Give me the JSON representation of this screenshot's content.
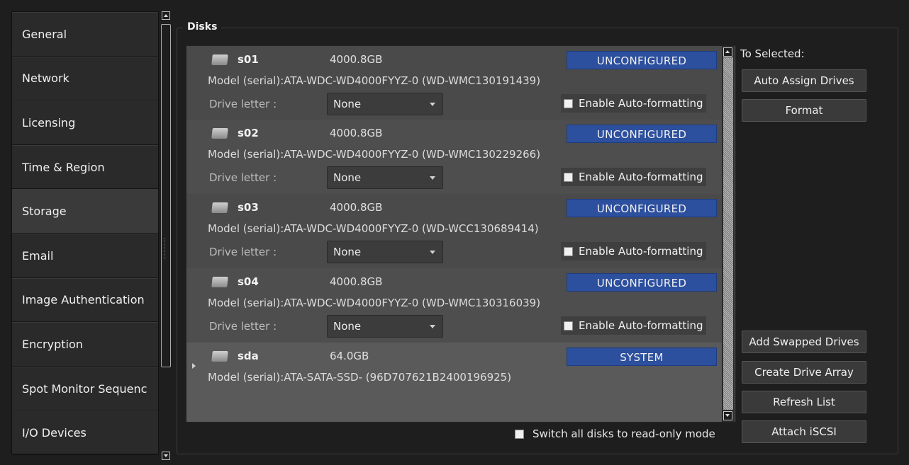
{
  "sidebar": {
    "items": [
      {
        "label": "General"
      },
      {
        "label": "Network"
      },
      {
        "label": "Licensing"
      },
      {
        "label": "Time & Region"
      },
      {
        "label": "Storage"
      },
      {
        "label": "Email"
      },
      {
        "label": "Image Authentication"
      },
      {
        "label": "Encryption"
      },
      {
        "label": "Spot Monitor Sequenc"
      },
      {
        "label": "I/O Devices"
      }
    ],
    "active_index": 4
  },
  "disks_group": {
    "title": "Disks",
    "drive_letter_label": "Drive letter :",
    "autoformat_label": "Enable Auto-formatting",
    "disks": [
      {
        "name": "s01",
        "size": "4000.8GB",
        "status": "UNCONFIGURED",
        "model": "Model (serial):ATA-WDC-WD4000FYYZ-0 (WD-WMC130191439)",
        "drive_letter": "None",
        "auto_format": false
      },
      {
        "name": "s02",
        "size": "4000.8GB",
        "status": "UNCONFIGURED",
        "model": "Model (serial):ATA-WDC-WD4000FYYZ-0 (WD-WMC130229266)",
        "drive_letter": "None",
        "auto_format": false
      },
      {
        "name": "s03",
        "size": "4000.8GB",
        "status": "UNCONFIGURED",
        "model": "Model (serial):ATA-WDC-WD4000FYYZ-0 (WD-WCC130689414)",
        "drive_letter": "None",
        "auto_format": false
      },
      {
        "name": "s04",
        "size": "4000.8GB",
        "status": "UNCONFIGURED",
        "model": "Model (serial):ATA-WDC-WD4000FYYZ-0 (WD-WMC130316039)",
        "drive_letter": "None",
        "auto_format": false
      },
      {
        "name": "sda",
        "size": "64.0GB",
        "status": "SYSTEM",
        "model": "Model (serial):ATA-SATA-SSD- (96D707621B2400196925)"
      }
    ],
    "to_selected_label": "To Selected:",
    "buttons": {
      "auto_assign": "Auto Assign Drives",
      "format": "Format",
      "add_swapped": "Add Swapped Drives",
      "create_array": "Create Drive Array",
      "refresh": "Refresh List",
      "attach_iscsi": "Attach iSCSI"
    },
    "readonly_label": "Switch all disks to read-only mode",
    "readonly_checked": false
  },
  "colors": {
    "badge": "#2c4f9e",
    "background": "#1e1e1e",
    "panel": "#4a4a4a"
  }
}
